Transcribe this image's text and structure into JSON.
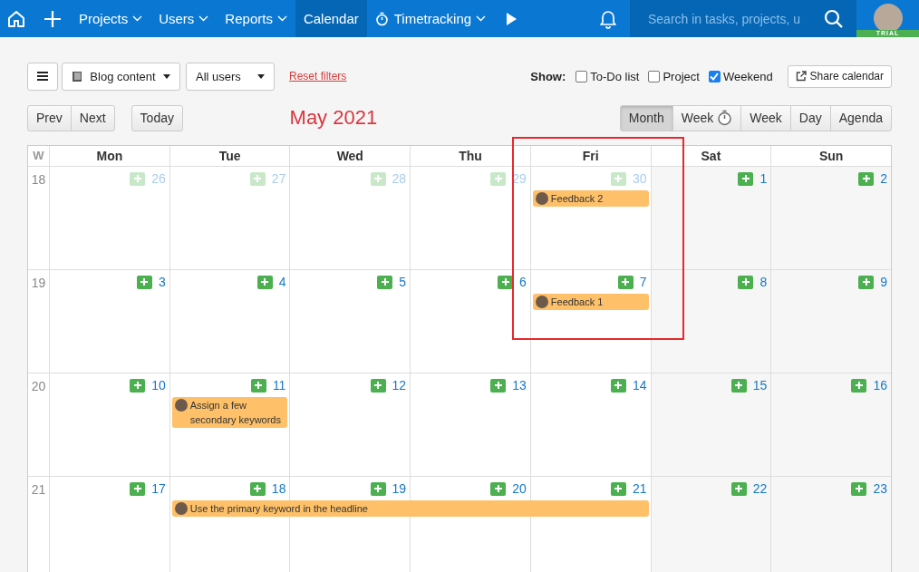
{
  "nav": {
    "items": [
      {
        "label": "Projects",
        "dropdown": true,
        "selected": false
      },
      {
        "label": "Users",
        "dropdown": true,
        "selected": false
      },
      {
        "label": "Reports",
        "dropdown": true,
        "selected": false
      },
      {
        "label": "Calendar",
        "dropdown": false,
        "selected": true
      },
      {
        "label": "Timetracking",
        "dropdown": true,
        "selected": false,
        "kind": "timer"
      }
    ],
    "search": {
      "placeholder": "Search in tasks, projects, u"
    },
    "badge": "TRIAL"
  },
  "filters": {
    "project": "Blog content",
    "users": "All users",
    "reset": "Reset filters",
    "show_label": "Show:",
    "options": [
      {
        "label": "To-Do list",
        "checked": false
      },
      {
        "label": "Project",
        "checked": false
      },
      {
        "label": "Weekend",
        "checked": true
      }
    ],
    "share": "Share calendar"
  },
  "nav_buttons": [
    "Prev",
    "Next"
  ],
  "today": "Today",
  "title": "May 2021",
  "views": [
    {
      "label": "Month",
      "selected": true
    },
    {
      "label": "Week",
      "selected": false,
      "kind": "timer"
    },
    {
      "label": "Week",
      "selected": false
    },
    {
      "label": "Day",
      "selected": false
    },
    {
      "label": "Agenda",
      "selected": false
    }
  ],
  "calendar": {
    "week_label": "W",
    "days": [
      "Mon",
      "Tue",
      "Wed",
      "Thu",
      "Fri",
      "Sat",
      "Sun"
    ],
    "weeks": [
      {
        "number": "18",
        "days": [
          {
            "date": "26",
            "muted": true
          },
          {
            "date": "27",
            "muted": true
          },
          {
            "date": "28",
            "muted": true
          },
          {
            "date": "29",
            "muted": true
          },
          {
            "date": "30",
            "muted": true,
            "events": [
              {
                "kind": "start",
                "title": "Feedback 2"
              }
            ]
          },
          {
            "date": "1",
            "muted": false
          },
          {
            "date": "2",
            "muted": false
          }
        ]
      },
      {
        "number": "19",
        "days": [
          {
            "date": "3",
            "muted": false
          },
          {
            "date": "4",
            "muted": false
          },
          {
            "date": "5",
            "muted": false
          },
          {
            "date": "6",
            "muted": false
          },
          {
            "date": "7",
            "muted": false,
            "events": [
              {
                "kind": "start",
                "title": "Feedback 1"
              }
            ]
          },
          {
            "date": "8",
            "muted": false
          },
          {
            "date": "9",
            "muted": false
          }
        ]
      },
      {
        "number": "20",
        "days": [
          {
            "date": "10",
            "muted": false
          },
          {
            "date": "11",
            "muted": false,
            "events": [
              {
                "kind": "start",
                "title": "Assign a few secondary keywords"
              }
            ]
          },
          {
            "date": "12",
            "muted": false
          },
          {
            "date": "13",
            "muted": false
          },
          {
            "date": "14",
            "muted": false
          },
          {
            "date": "15",
            "muted": false
          },
          {
            "date": "16",
            "muted": false
          }
        ]
      },
      {
        "number": "21",
        "days": [
          {
            "date": "17",
            "muted": false
          },
          {
            "date": "18",
            "muted": false,
            "events": [
              {
                "kind": "start",
                "title": "Use the primary keyword in the headline"
              }
            ]
          },
          {
            "date": "19",
            "muted": false,
            "events": [
              {
                "kind": "continued"
              }
            ]
          },
          {
            "date": "20",
            "muted": false,
            "events": [
              {
                "kind": "continued"
              }
            ]
          },
          {
            "date": "21",
            "muted": false,
            "events": [
              {
                "kind": "continued"
              }
            ]
          },
          {
            "date": "22",
            "muted": false
          },
          {
            "date": "23",
            "muted": false
          }
        ]
      }
    ]
  }
}
